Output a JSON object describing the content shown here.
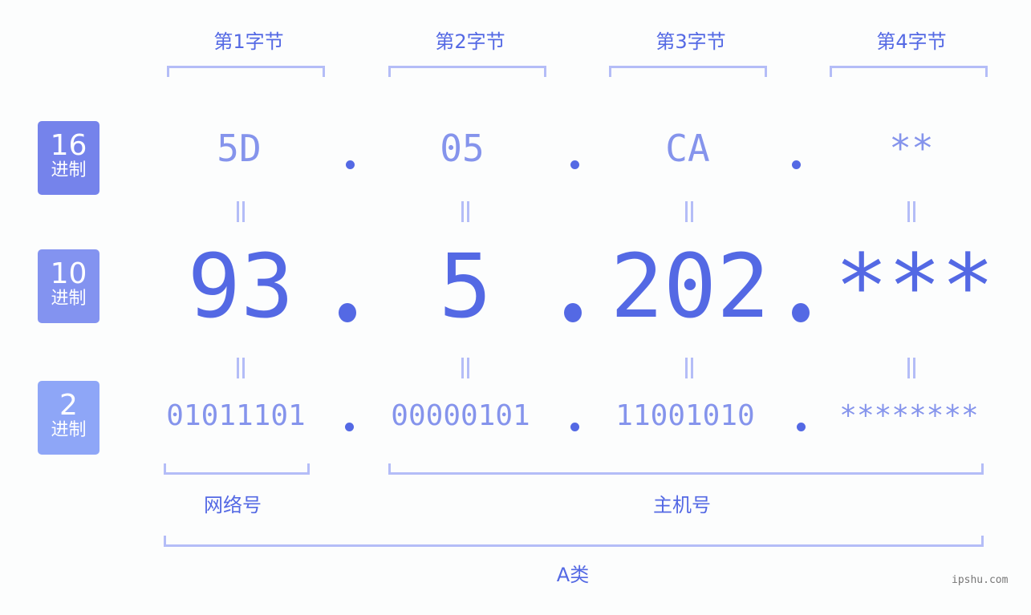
{
  "bytes": [
    {
      "label": "第1字节",
      "hex": "5D",
      "dec": "93",
      "bin": "01011101"
    },
    {
      "label": "第2字节",
      "hex": "05",
      "dec": "5",
      "bin": "00000101"
    },
    {
      "label": "第3字节",
      "hex": "CA",
      "dec": "202",
      "bin": "11001010"
    },
    {
      "label": "第4字节",
      "hex": "**",
      "dec": "***",
      "bin": "********"
    }
  ],
  "badges": {
    "hex": {
      "num": "16",
      "unit": "进制",
      "color": "#7583eb"
    },
    "dec": {
      "num": "10",
      "unit": "进制",
      "color": "#8393f0"
    },
    "bin": {
      "num": "2",
      "unit": "进制",
      "color": "#8ea6f7"
    }
  },
  "sections": {
    "network": "网络号",
    "host": "主机号",
    "class": "A类"
  },
  "watermark": "ipshu.com",
  "colors": {
    "accent": "#5469e4",
    "light": "#8594ec",
    "bracket": "#b4bdf7"
  }
}
